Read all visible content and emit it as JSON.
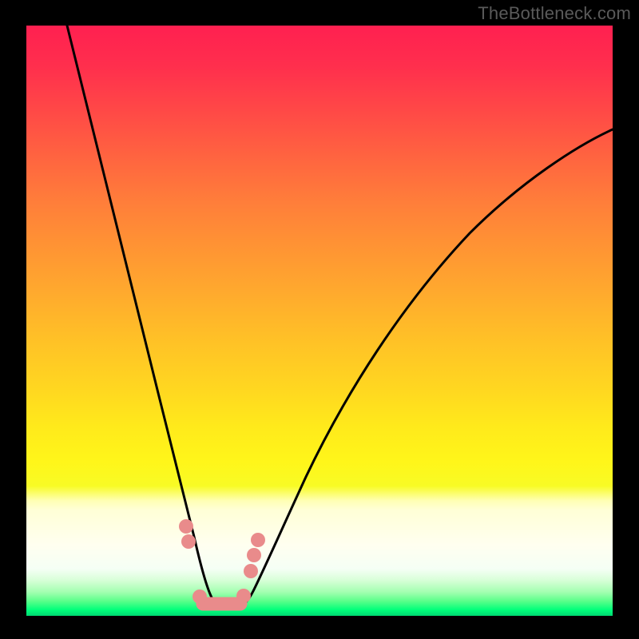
{
  "watermark": "TheBottleneck.com",
  "colors": {
    "curve_stroke": "#000000",
    "marker_fill": "#e98b8b",
    "marker_stroke": "#c46b6b",
    "background": "#000000"
  },
  "chart_data": {
    "type": "line",
    "title": "",
    "xlabel": "",
    "ylabel": "",
    "xlim": [
      0,
      100
    ],
    "ylim": [
      0,
      100
    ],
    "grid": false,
    "legend": false,
    "note": "Axes are unlabeled in the image; values below are relative percentages (0–100) estimated from pixel position. Curve is a V-shaped bottleneck profile with minimum near x≈33.",
    "series": [
      {
        "name": "bottleneck-curve",
        "x": [
          7,
          10,
          13,
          16,
          19,
          22,
          24,
          26,
          28,
          29,
          30,
          31,
          32,
          33,
          34,
          35,
          36,
          38,
          40,
          43,
          47,
          52,
          58,
          65,
          73,
          82,
          92,
          100
        ],
        "y": [
          100,
          86,
          72,
          58,
          45,
          33,
          24,
          17,
          11,
          7,
          4,
          2,
          1,
          1,
          1,
          2,
          3,
          6,
          10,
          16,
          24,
          33,
          43,
          53,
          62,
          70,
          76,
          80
        ]
      }
    ],
    "markers": {
      "name": "highlighted-points",
      "note": "Salmon dots and the flat segment at the valley bottom.",
      "x": [
        26.5,
        27.2,
        29.5,
        31,
        33,
        35,
        36.8,
        38,
        38.6,
        39.3
      ],
      "y": [
        14.5,
        12,
        2.5,
        2,
        2,
        2,
        2.5,
        7,
        10,
        12.5
      ]
    }
  }
}
